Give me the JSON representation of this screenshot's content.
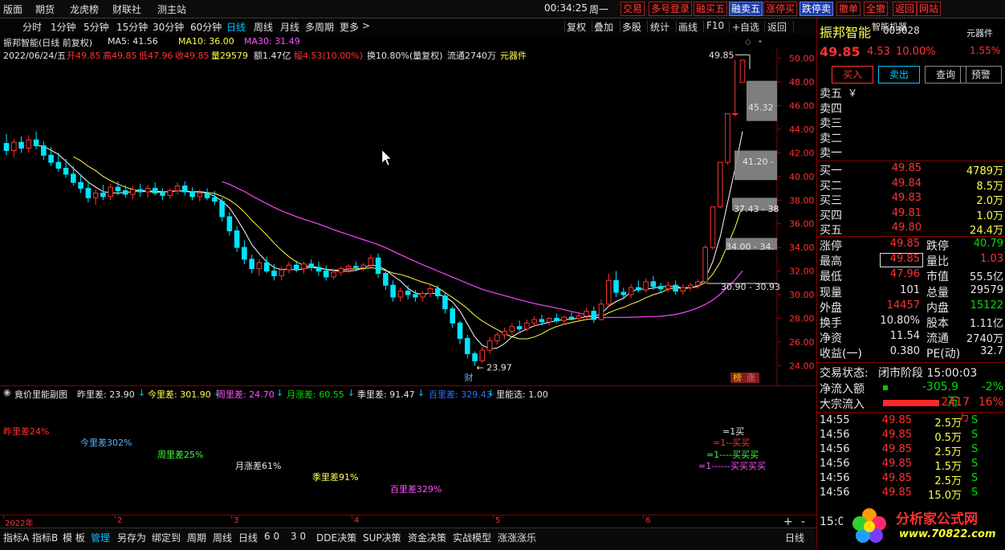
{
  "menu": [
    "版面",
    "期货",
    "龙虎榜",
    "财联社",
    "测主站"
  ],
  "clock": "00:34:25",
  "weekday": "周一",
  "trade_buttons": [
    {
      "label": "交易",
      "hl": false
    },
    {
      "label": "多号登录",
      "hl": false
    },
    {
      "label": "融买五",
      "hl": false
    },
    {
      "label": "融卖五",
      "hl": true
    },
    {
      "label": "涨停买",
      "hl": false
    },
    {
      "label": "跌停卖",
      "hl": true
    },
    {
      "label": "撤单",
      "hl": false
    },
    {
      "label": "全撤",
      "hl": false
    },
    {
      "label": "返回",
      "hl": false
    },
    {
      "label": "网站",
      "hl": false
    }
  ],
  "periods": [
    {
      "label": "分时",
      "active": false
    },
    {
      "label": "1分钟",
      "active": false
    },
    {
      "label": "5分钟",
      "active": false
    },
    {
      "label": "15分钟",
      "active": false
    },
    {
      "label": "30分钟",
      "active": false
    },
    {
      "label": "60分钟",
      "active": false
    },
    {
      "label": "日线",
      "active": true
    },
    {
      "label": "周线",
      "active": false
    },
    {
      "label": "月线",
      "active": false
    },
    {
      "label": "多周期",
      "active": false
    },
    {
      "label": "更多",
      "active": false
    }
  ],
  "more_arrow": ">",
  "right_tools": [
    "复权",
    "叠加",
    "多股",
    "统计",
    "画线",
    "F10",
    "+自选",
    "返回"
  ],
  "chart_info": {
    "stock_title": "振邦智能(日线 前复权)",
    "ma5": "MA5: 41.56",
    "ma10": "MA10: 36.00",
    "ma30": "MA30: 31.49",
    "date": "2022/06/24/五",
    "open": "开49.85",
    "high": "高49.85",
    "low": "低47.96",
    "close": "收49.85",
    "vol": "量29579",
    "amount": "额1.47亿",
    "chg": "幅4.53(10.00%)",
    "turnover": "换10.80%(量复权)",
    "float": "流通2740万",
    "plugin": "元器件"
  },
  "price_axis": [
    "50.00",
    "48.00",
    "46.00",
    "44.00",
    "42.00",
    "40.00",
    "38.00",
    "36.00",
    "34.00",
    "32.00",
    "30.00",
    "28.00",
    "26.00",
    "24.00"
  ],
  "chart_labels": {
    "high_marker": "49.85",
    "low_marker": "23.97",
    "box1": "45.32",
    "box2": "41.20 -",
    "box3": "37.43 - 38",
    "box4": "34.00 - 34.",
    "box5": "30.90 - 30.93",
    "cai": "财",
    "bang": "榜",
    "zhang": "涨"
  },
  "chart_data": {
    "type": "candlestick",
    "dates": [
      "2022-01-04",
      "2022-06-24"
    ],
    "candles": [
      {
        "o": 42.8,
        "h": 43.6,
        "l": 41.8,
        "c": 42.2
      },
      {
        "o": 42.2,
        "h": 43.2,
        "l": 41.6,
        "c": 42.9
      },
      {
        "o": 42.9,
        "h": 43.4,
        "l": 42.0,
        "c": 42.4
      },
      {
        "o": 42.4,
        "h": 43.5,
        "l": 42.0,
        "c": 43.1
      },
      {
        "o": 43.1,
        "h": 43.8,
        "l": 42.3,
        "c": 42.6
      },
      {
        "o": 42.6,
        "h": 43.0,
        "l": 41.4,
        "c": 41.8
      },
      {
        "o": 41.8,
        "h": 42.5,
        "l": 40.9,
        "c": 41.2
      },
      {
        "o": 41.2,
        "h": 42.0,
        "l": 40.4,
        "c": 40.7
      },
      {
        "o": 40.7,
        "h": 41.5,
        "l": 39.9,
        "c": 40.2
      },
      {
        "o": 40.2,
        "h": 40.9,
        "l": 39.2,
        "c": 39.5
      },
      {
        "o": 39.5,
        "h": 40.2,
        "l": 38.6,
        "c": 39.0
      },
      {
        "o": 39.0,
        "h": 39.6,
        "l": 37.8,
        "c": 38.2
      },
      {
        "o": 38.2,
        "h": 38.9,
        "l": 37.6,
        "c": 38.6
      },
      {
        "o": 38.6,
        "h": 39.3,
        "l": 38.0,
        "c": 38.3
      },
      {
        "o": 38.3,
        "h": 39.4,
        "l": 38.0,
        "c": 39.1
      },
      {
        "o": 39.1,
        "h": 39.6,
        "l": 38.4,
        "c": 38.8
      },
      {
        "o": 38.8,
        "h": 39.3,
        "l": 38.2,
        "c": 38.5
      },
      {
        "o": 38.5,
        "h": 39.2,
        "l": 38.1,
        "c": 38.9
      },
      {
        "o": 38.9,
        "h": 39.4,
        "l": 38.3,
        "c": 38.7
      },
      {
        "o": 38.7,
        "h": 39.3,
        "l": 38.2,
        "c": 39.0
      },
      {
        "o": 39.0,
        "h": 39.5,
        "l": 38.4,
        "c": 38.6
      },
      {
        "o": 38.6,
        "h": 39.0,
        "l": 38.0,
        "c": 38.4
      },
      {
        "o": 38.4,
        "h": 39.0,
        "l": 38.1,
        "c": 38.8
      },
      {
        "o": 38.8,
        "h": 39.5,
        "l": 38.5,
        "c": 39.2
      },
      {
        "o": 39.2,
        "h": 39.6,
        "l": 38.4,
        "c": 38.7
      },
      {
        "o": 38.7,
        "h": 39.1,
        "l": 38.0,
        "c": 38.3
      },
      {
        "o": 38.3,
        "h": 38.9,
        "l": 37.9,
        "c": 38.6
      },
      {
        "o": 38.6,
        "h": 39.0,
        "l": 38.0,
        "c": 38.2
      },
      {
        "o": 38.2,
        "h": 38.8,
        "l": 37.6,
        "c": 37.9
      },
      {
        "o": 37.9,
        "h": 38.2,
        "l": 36.2,
        "c": 36.6
      },
      {
        "o": 36.6,
        "h": 37.0,
        "l": 35.0,
        "c": 35.4
      },
      {
        "o": 35.4,
        "h": 35.8,
        "l": 33.6,
        "c": 34.0
      },
      {
        "o": 34.0,
        "h": 34.6,
        "l": 32.6,
        "c": 33.0
      },
      {
        "o": 33.0,
        "h": 33.4,
        "l": 31.8,
        "c": 32.2
      },
      {
        "o": 32.2,
        "h": 33.0,
        "l": 31.6,
        "c": 32.7
      },
      {
        "o": 32.7,
        "h": 33.2,
        "l": 31.8,
        "c": 32.0
      },
      {
        "o": 32.0,
        "h": 32.6,
        "l": 31.2,
        "c": 31.6
      },
      {
        "o": 31.6,
        "h": 32.4,
        "l": 31.2,
        "c": 32.1
      },
      {
        "o": 32.1,
        "h": 32.8,
        "l": 31.8,
        "c": 32.5
      },
      {
        "o": 32.5,
        "h": 32.9,
        "l": 31.9,
        "c": 32.2
      },
      {
        "o": 32.2,
        "h": 32.8,
        "l": 31.8,
        "c": 32.6
      },
      {
        "o": 32.6,
        "h": 33.0,
        "l": 32.0,
        "c": 32.3
      },
      {
        "o": 32.3,
        "h": 32.8,
        "l": 31.6,
        "c": 32.0
      },
      {
        "o": 32.0,
        "h": 32.5,
        "l": 31.2,
        "c": 31.5
      },
      {
        "o": 31.5,
        "h": 32.2,
        "l": 31.3,
        "c": 31.9
      },
      {
        "o": 31.9,
        "h": 32.4,
        "l": 31.6,
        "c": 32.2
      },
      {
        "o": 32.2,
        "h": 32.6,
        "l": 31.8,
        "c": 32.4
      },
      {
        "o": 32.4,
        "h": 32.8,
        "l": 32.0,
        "c": 32.3
      },
      {
        "o": 32.3,
        "h": 32.7,
        "l": 32.0,
        "c": 32.5
      },
      {
        "o": 32.5,
        "h": 33.4,
        "l": 32.2,
        "c": 33.1
      },
      {
        "o": 33.1,
        "h": 33.5,
        "l": 31.4,
        "c": 31.8
      },
      {
        "o": 31.8,
        "h": 32.0,
        "l": 30.4,
        "c": 30.8
      },
      {
        "o": 30.8,
        "h": 31.2,
        "l": 29.4,
        "c": 29.8
      },
      {
        "o": 29.8,
        "h": 30.6,
        "l": 29.4,
        "c": 30.3
      },
      {
        "o": 30.3,
        "h": 30.8,
        "l": 29.6,
        "c": 30.0
      },
      {
        "o": 30.0,
        "h": 30.4,
        "l": 29.4,
        "c": 29.8
      },
      {
        "o": 29.8,
        "h": 30.3,
        "l": 29.4,
        "c": 30.1
      },
      {
        "o": 30.1,
        "h": 30.8,
        "l": 29.8,
        "c": 30.5
      },
      {
        "o": 30.5,
        "h": 30.8,
        "l": 29.6,
        "c": 29.9
      },
      {
        "o": 29.9,
        "h": 30.2,
        "l": 28.4,
        "c": 28.8
      },
      {
        "o": 28.8,
        "h": 29.0,
        "l": 27.2,
        "c": 27.6
      },
      {
        "o": 27.6,
        "h": 27.8,
        "l": 25.8,
        "c": 26.3
      },
      {
        "o": 26.3,
        "h": 26.6,
        "l": 24.6,
        "c": 25.0
      },
      {
        "o": 25.0,
        "h": 25.2,
        "l": 23.97,
        "c": 24.4
      },
      {
        "o": 24.4,
        "h": 25.6,
        "l": 24.2,
        "c": 25.3
      },
      {
        "o": 25.3,
        "h": 26.4,
        "l": 25.0,
        "c": 26.1
      },
      {
        "o": 26.1,
        "h": 26.8,
        "l": 25.8,
        "c": 26.6
      },
      {
        "o": 26.6,
        "h": 27.2,
        "l": 26.2,
        "c": 26.9
      },
      {
        "o": 26.9,
        "h": 27.6,
        "l": 26.6,
        "c": 27.3
      },
      {
        "o": 27.3,
        "h": 27.8,
        "l": 26.9,
        "c": 27.1
      },
      {
        "o": 27.1,
        "h": 27.9,
        "l": 26.9,
        "c": 27.6
      },
      {
        "o": 27.6,
        "h": 28.2,
        "l": 27.3,
        "c": 27.9
      },
      {
        "o": 27.9,
        "h": 28.3,
        "l": 27.4,
        "c": 27.7
      },
      {
        "o": 27.7,
        "h": 28.1,
        "l": 27.4,
        "c": 28.0
      },
      {
        "o": 28.0,
        "h": 28.4,
        "l": 27.6,
        "c": 27.8
      },
      {
        "o": 27.8,
        "h": 28.2,
        "l": 27.5,
        "c": 28.1
      },
      {
        "o": 28.1,
        "h": 28.5,
        "l": 27.8,
        "c": 28.0
      },
      {
        "o": 28.0,
        "h": 28.4,
        "l": 27.7,
        "c": 28.2
      },
      {
        "o": 28.2,
        "h": 28.9,
        "l": 27.9,
        "c": 28.6
      },
      {
        "o": 28.6,
        "h": 29.0,
        "l": 27.6,
        "c": 27.9
      },
      {
        "o": 27.9,
        "h": 29.6,
        "l": 27.8,
        "c": 29.2
      },
      {
        "o": 29.2,
        "h": 31.8,
        "l": 29.0,
        "c": 31.2
      },
      {
        "o": 31.2,
        "h": 32.0,
        "l": 29.8,
        "c": 30.2
      },
      {
        "o": 30.2,
        "h": 30.6,
        "l": 29.6,
        "c": 30.0
      },
      {
        "o": 30.0,
        "h": 30.9,
        "l": 29.7,
        "c": 30.6
      },
      {
        "o": 30.6,
        "h": 31.2,
        "l": 30.2,
        "c": 30.4
      },
      {
        "o": 30.4,
        "h": 31.4,
        "l": 30.2,
        "c": 31.1
      },
      {
        "o": 31.1,
        "h": 31.6,
        "l": 30.4,
        "c": 30.7
      },
      {
        "o": 30.7,
        "h": 31.0,
        "l": 30.1,
        "c": 30.5
      },
      {
        "o": 30.5,
        "h": 31.1,
        "l": 30.2,
        "c": 30.8
      },
      {
        "o": 30.8,
        "h": 31.2,
        "l": 30.0,
        "c": 30.3
      },
      {
        "o": 30.3,
        "h": 30.9,
        "l": 30.0,
        "c": 30.6
      },
      {
        "o": 30.6,
        "h": 31.0,
        "l": 30.3,
        "c": 30.8
      },
      {
        "o": 30.8,
        "h": 31.3,
        "l": 30.5,
        "c": 31.1
      },
      {
        "o": 31.1,
        "h": 34.2,
        "l": 31.0,
        "c": 34.0
      },
      {
        "o": 34.0,
        "h": 37.4,
        "l": 33.8,
        "c": 37.43
      },
      {
        "o": 37.43,
        "h": 41.2,
        "l": 37.3,
        "c": 41.2
      },
      {
        "o": 41.2,
        "h": 45.32,
        "l": 41.0,
        "c": 45.32
      },
      {
        "o": 45.32,
        "h": 49.85,
        "l": 45.1,
        "c": 45.32
      },
      {
        "o": 47.96,
        "h": 49.85,
        "l": 47.96,
        "c": 49.85
      }
    ],
    "ma5_last": 41.56,
    "ma10_last": 36.0,
    "ma30_last": 31.49,
    "ylim": [
      23,
      51
    ]
  },
  "sub_info": {
    "title": "竟价里能副图",
    "zuo": "昨里差: 23.90",
    "jin": "今里差: 301.90",
    "zhou": "周里差: 24.70",
    "yue": "月涨差: 60.55",
    "ji": "季里差: 91.47",
    "bai": "百里差: 329.43",
    "xuan": "里能选: 1.00",
    "lbl_zuo": "昨里差24%",
    "lbl_jin": "今里差302%",
    "lbl_zhou": "周里差25%",
    "lbl_yue": "月涨差61%",
    "lbl_ji": "季里差91%",
    "lbl_bai": "百里差329%",
    "legend1": "=1买",
    "legend2": "=1--买买",
    "legend3": "=1----买买买",
    "legend4": "=1------买买买买"
  },
  "time_axis": [
    "2022年",
    "2",
    "3",
    "4",
    "5",
    "6"
  ],
  "bottom_tabs": [
    {
      "label": "指标A",
      "active": false
    },
    {
      "label": "指标B",
      "active": false
    },
    {
      "label": "模 板",
      "active": false
    },
    {
      "label": "管理",
      "active": true
    },
    {
      "label": "另存为",
      "active": false
    },
    {
      "label": "绑定到",
      "active": false
    },
    {
      "label": "周期",
      "active": false
    },
    {
      "label": "周线",
      "active": false
    },
    {
      "label": "日线",
      "active": false
    },
    {
      "label": "6 0",
      "active": false
    },
    {
      "label": "3 0",
      "active": false
    },
    {
      "label": "DDE决策",
      "active": false
    },
    {
      "label": "SUP决策",
      "active": false
    },
    {
      "label": "资金决策",
      "active": false
    },
    {
      "label": "实战模型",
      "active": false
    },
    {
      "label": "涨涨涨乐",
      "active": false
    }
  ],
  "bottom_right": "日线",
  "quote": {
    "name": "振邦智能",
    "tag": "智能机器",
    "code": "003028",
    "sector": "元器件",
    "sector_chg": "1.55%",
    "price": "49.85",
    "change": "4.53",
    "pct": "10.00%",
    "buy_btn": "买入",
    "sell_btn": "卖出",
    "query_btn": "查询",
    "alert_btn": "预警",
    "sell_levels": [
      {
        "label": "卖五",
        "extra": "￥"
      },
      {
        "label": "卖四",
        "extra": ""
      },
      {
        "label": "卖三",
        "extra": ""
      },
      {
        "label": "卖二",
        "extra": ""
      },
      {
        "label": "卖一",
        "extra": ""
      }
    ],
    "buy_levels": [
      {
        "label": "买一",
        "price": "49.85",
        "vol": "4789万"
      },
      {
        "label": "买二",
        "price": "49.84",
        "vol": "8.5万"
      },
      {
        "label": "买三",
        "price": "49.83",
        "vol": "2.0万"
      },
      {
        "label": "买四",
        "price": "49.81",
        "vol": "1.0万"
      },
      {
        "label": "买五",
        "price": "49.80",
        "vol": "24.4万"
      }
    ],
    "stats": [
      {
        "l1": "涨停",
        "v1": "49.85",
        "c1": "red",
        "l2": "跌停",
        "v2": "40.79",
        "c2": "green"
      },
      {
        "l1": "最高",
        "v1": "49.85",
        "c1": "red",
        "l2": "量比",
        "v2": "1.03",
        "c2": "red"
      },
      {
        "l1": "最低",
        "v1": "47.96",
        "c1": "red",
        "l2": "市值",
        "v2": "55.5亿",
        "c2": "white"
      },
      {
        "l1": "现量",
        "v1": "101",
        "c1": "white",
        "l2": "总量",
        "v2": "29579",
        "c2": "white"
      },
      {
        "l1": "外盘",
        "v1": "14457",
        "c1": "red",
        "l2": "内盘",
        "v2": "15122",
        "c2": "green"
      },
      {
        "l1": "换手",
        "v1": "10.80%",
        "c1": "white",
        "l2": "股本",
        "v2": "1.11亿",
        "c2": "white"
      },
      {
        "l1": "净资",
        "v1": "11.54",
        "c1": "white",
        "l2": "流通",
        "v2": "2740万",
        "c2": "white"
      },
      {
        "l1": "收益(一)",
        "v1": "0.380",
        "c1": "white",
        "l2": "PE(动)",
        "v2": "32.7",
        "c2": "white"
      }
    ],
    "status_label": "交易状态:",
    "status_val": "闭市阶段 15:00:03",
    "netflow_label": "净流入额",
    "netflow_val": "-305.9万",
    "netflow_pct": "-2%",
    "block_label": "大宗流入",
    "block_val": "2417万",
    "block_pct": "16%",
    "ticks": [
      {
        "t": "14:55",
        "p": "49.85",
        "v": "2.5万",
        "s": "S"
      },
      {
        "t": "14:56",
        "p": "49.85",
        "v": "0.5万",
        "s": "S"
      },
      {
        "t": "14:56",
        "p": "49.85",
        "v": "2.5万",
        "s": "S"
      },
      {
        "t": "14:56",
        "p": "49.85",
        "v": "1.5万",
        "s": "S"
      },
      {
        "t": "14:56",
        "p": "49.85",
        "v": "2.5万",
        "s": "S"
      },
      {
        "t": "14:56",
        "p": "49.85",
        "v": "15.0万",
        "s": "S"
      }
    ],
    "tick_last_time": "15:0",
    "logo_text": "分析家公式网",
    "logo_url": "www.70822.com"
  },
  "colors": {
    "up": "#ff3232",
    "down": "#00e5ff",
    "ma5": "#ffffff",
    "ma10": "#ffff4a",
    "ma30": "#ff44ff"
  }
}
